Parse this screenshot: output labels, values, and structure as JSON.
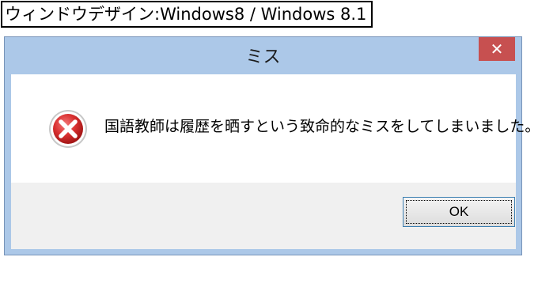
{
  "caption": "ウィンドウデザイン:Windows8 / Windows 8.1",
  "dialog": {
    "title": "ミス",
    "close_glyph": "✕",
    "icon": "error-icon",
    "message": "国語教師は履歴を晒すという致命的なミスをしてしまいました。",
    "ok_label": "OK"
  },
  "colors": {
    "frame": "#acc8e8",
    "close_button": "#c75050",
    "error_red": "#d93030",
    "button_area": "#f0f0f0"
  }
}
